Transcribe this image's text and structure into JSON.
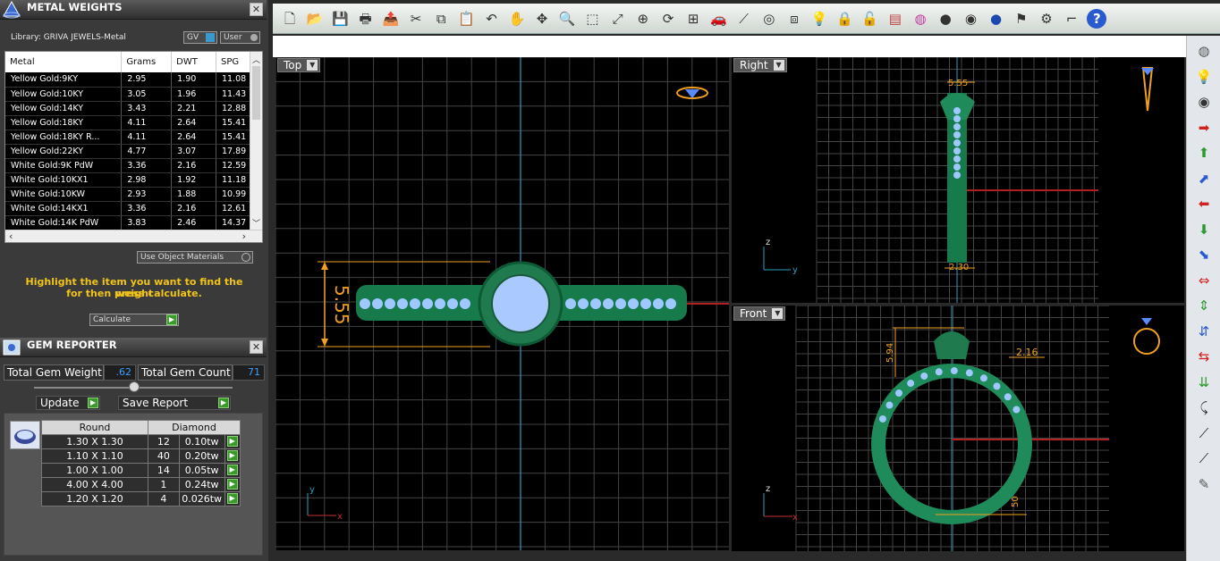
{
  "metal_weights": {
    "title": "METAL WEIGHTS",
    "close": "✕",
    "library_label": "Library: GRIVA JEWELS-Metal",
    "gv_label": "GV",
    "user_label": "User",
    "columns": [
      "Metal",
      "Grams",
      "DWT",
      "SPG"
    ],
    "rows": [
      [
        "Yellow Gold:9KY",
        "2.95",
        "1.90",
        "11.08"
      ],
      [
        "Yellow Gold:10KY",
        "3.05",
        "1.96",
        "11.43"
      ],
      [
        "Yellow Gold:14KY",
        "3.43",
        "2.21",
        "12.88"
      ],
      [
        "Yellow Gold:18KY",
        "4.11",
        "2.64",
        "15.41"
      ],
      [
        "Yellow Gold:18KY R...",
        "4.11",
        "2.64",
        "15.41"
      ],
      [
        "Yellow Gold:22KY",
        "4.77",
        "3.07",
        "17.89"
      ],
      [
        "White Gold:9K PdW",
        "3.36",
        "2.16",
        "12.59"
      ],
      [
        "White Gold:10KX1",
        "2.98",
        "1.92",
        "11.18"
      ],
      [
        "White Gold:10KW",
        "2.93",
        "1.88",
        "10.99"
      ],
      [
        "White Gold:14KX1",
        "3.36",
        "2.16",
        "12.61"
      ],
      [
        "White Gold:14K PdW",
        "3.83",
        "2.46",
        "14.37"
      ]
    ],
    "use_object_materials": "Use Object Materials",
    "instruction_line1": "Highlight the item you want to find the weight",
    "instruction_line2": "for then press calculate.",
    "calculate": "Calculate"
  },
  "gem_reporter": {
    "title": "GEM REPORTER",
    "close": "✕",
    "total_weight_label": "Total Gem Weight",
    "total_weight_value": ".62",
    "total_count_label": "Total Gem Count",
    "total_count_value": "71",
    "update": "Update",
    "save_report": "Save Report",
    "columns": [
      "Round",
      "Diamond"
    ],
    "rows": [
      [
        "1.30 X 1.30",
        "12",
        "0.10tw"
      ],
      [
        "1.10 X 1.10",
        "40",
        "0.20tw"
      ],
      [
        "1.00 X 1.00",
        "14",
        "0.05tw"
      ],
      [
        "4.00 X 4.00",
        "1",
        "0.24tw"
      ],
      [
        "1.20 X 1.20",
        "4",
        "0.026tw"
      ]
    ]
  },
  "toolbar": {
    "icons": [
      "new-file-icon",
      "open-folder-icon",
      "save-icon",
      "print-icon",
      "export-icon",
      "cut-icon",
      "copy-icon",
      "paste-icon",
      "undo-icon",
      "pan-hand-icon",
      "move-icon",
      "zoom-in-icon",
      "zoom-window-icon",
      "zoom-extents-icon",
      "zoom-selected-icon",
      "rotate-view-icon",
      "four-view-icon",
      "car-icon",
      "tilt-view-icon",
      "target-icon",
      "object-snap-icon",
      "light-bulb-icon",
      "lock-icon",
      "unlock-icon",
      "layer-icon",
      "color-wheel-icon",
      "shade-sphere-icon",
      "render-sphere-icon",
      "blue-sphere-icon",
      "flag-icon",
      "settings-gear-icon",
      "dimension-icon",
      "help-icon"
    ]
  },
  "viewports": {
    "top": {
      "label": "Top",
      "dim": "5.55",
      "axis_y": "y",
      "axis_x": "x"
    },
    "right": {
      "label": "Right",
      "dim_top": "5.55",
      "dim_bottom": "2.30",
      "axis_z": "z",
      "axis_y": "y"
    },
    "front": {
      "label": "Front",
      "dim_left": "5.94",
      "dim_right": "2.16",
      "dim_bottom": "50",
      "axis_z": "z",
      "axis_x": "x"
    }
  },
  "right_toolbar": {
    "icons": [
      "wireframe-sphere-icon",
      "bulb-icon",
      "shaded-sphere-icon",
      "arrow-right-icon",
      "arrow-up-icon",
      "arrow-up-tilt-icon",
      "arrow-left-icon",
      "arrow-down-icon",
      "arrow-down-tilt-icon",
      "arrows-horizontal-icon",
      "arrows-vertical-icon",
      "arrows-in-vertical-icon",
      "arrows-in-horizontal-icon",
      "arrows-down-stack-icon",
      "curve-tool-icon",
      "line-tool-icon",
      "line-tool-2-icon",
      "eraser-icon"
    ]
  },
  "colors": {
    "accent_green": "#1f8a5a",
    "gem_blue": "#9ec8ff",
    "dim_orange": "#f0a020",
    "axis_cyan": "#3aa0c0"
  }
}
